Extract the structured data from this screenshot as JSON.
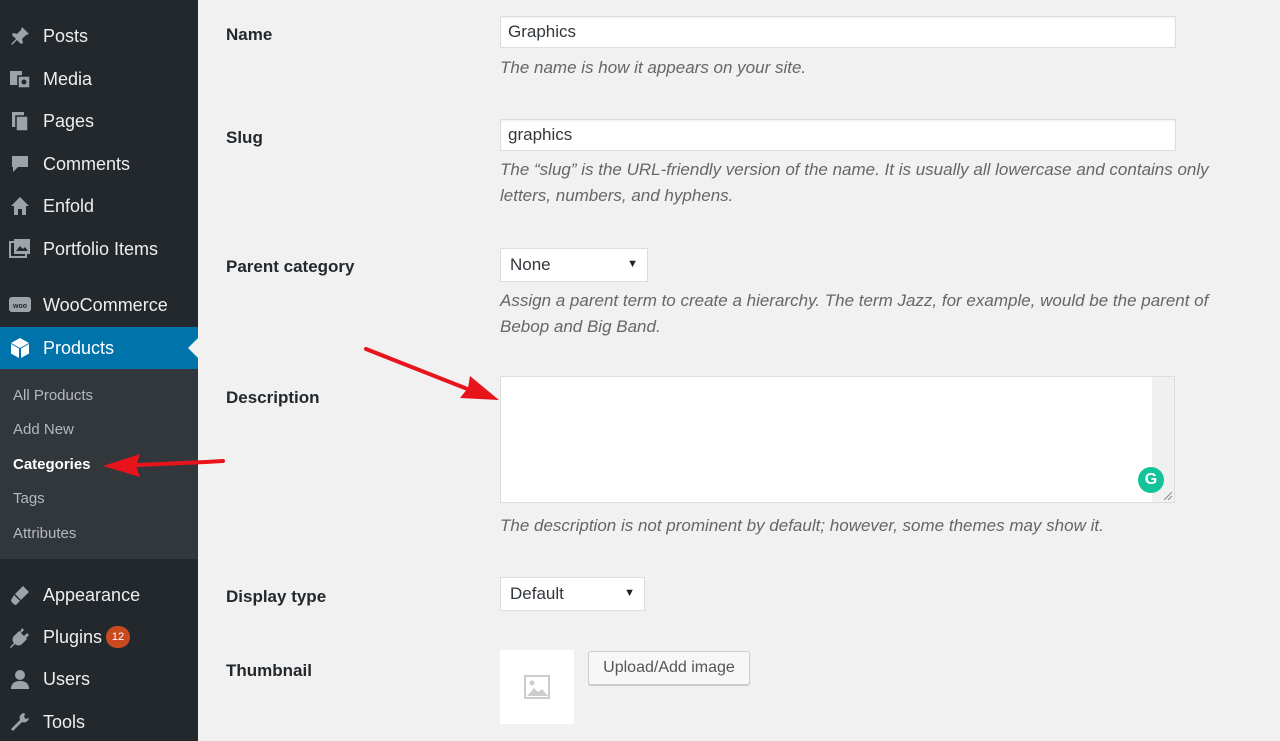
{
  "sidebar": {
    "items": [
      {
        "label": "Posts",
        "icon": "pin-icon"
      },
      {
        "label": "Media",
        "icon": "media-icon"
      },
      {
        "label": "Pages",
        "icon": "pages-icon"
      },
      {
        "label": "Comments",
        "icon": "comment-icon"
      },
      {
        "label": "Enfold",
        "icon": "home-icon"
      },
      {
        "label": "Portfolio Items",
        "icon": "portfolio-icon"
      },
      {
        "label": "WooCommerce",
        "icon": "woocommerce-icon"
      },
      {
        "label": "Products",
        "icon": "products-icon",
        "current": true
      },
      {
        "label": "Appearance",
        "icon": "appearance-icon"
      },
      {
        "label": "Plugins",
        "icon": "plugins-icon",
        "badge": "12"
      },
      {
        "label": "Users",
        "icon": "users-icon"
      },
      {
        "label": "Tools",
        "icon": "tools-icon"
      }
    ],
    "submenu": [
      {
        "label": "All Products"
      },
      {
        "label": "Add New"
      },
      {
        "label": "Categories",
        "current": true
      },
      {
        "label": "Tags"
      },
      {
        "label": "Attributes"
      }
    ]
  },
  "form": {
    "name": {
      "label": "Name",
      "value": "Graphics",
      "hint": "The name is how it appears on your site."
    },
    "slug": {
      "label": "Slug",
      "value": "graphics",
      "hint": "The “slug” is the URL-friendly version of the name. It is usually all lowercase and contains only letters, numbers, and hyphens."
    },
    "parent": {
      "label": "Parent category",
      "selected": "None",
      "hint": "Assign a parent term to create a hierarchy. The term Jazz, for example, would be the parent of Bebop and Big Band."
    },
    "description": {
      "label": "Description",
      "value": "",
      "hint": "The description is not prominent by default; however, some themes may show it."
    },
    "display_type": {
      "label": "Display type",
      "selected": "Default"
    },
    "thumbnail": {
      "label": "Thumbnail",
      "upload_label": "Upload/Add image"
    }
  },
  "colors": {
    "sidebar_bg": "#23282d",
    "submenu_bg": "#32373c",
    "current_bg": "#0073aa",
    "badge": "#ca4a1f",
    "annotation_arrow": "#e8141c",
    "grammarly": "#15c39a"
  }
}
